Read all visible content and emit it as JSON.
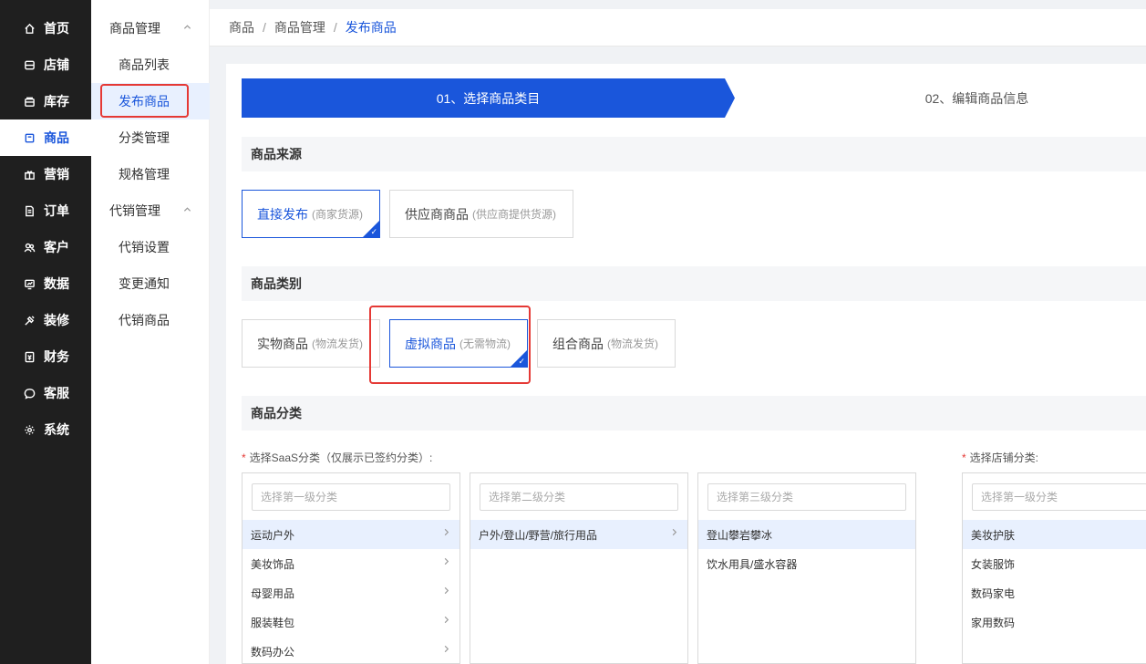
{
  "nav": {
    "items": [
      {
        "label": "首页",
        "icon": "home-icon"
      },
      {
        "label": "店铺",
        "icon": "store-icon"
      },
      {
        "label": "库存",
        "icon": "inventory-icon"
      },
      {
        "label": "商品",
        "icon": "product-icon"
      },
      {
        "label": "营销",
        "icon": "gift-icon"
      },
      {
        "label": "订单",
        "icon": "order-icon"
      },
      {
        "label": "客户",
        "icon": "customer-icon"
      },
      {
        "label": "数据",
        "icon": "data-icon"
      },
      {
        "label": "装修",
        "icon": "decorate-icon"
      },
      {
        "label": "财务",
        "icon": "finance-icon"
      },
      {
        "label": "客服",
        "icon": "chat-icon"
      },
      {
        "label": "系统",
        "icon": "settings-icon"
      }
    ],
    "active": "商品"
  },
  "submenu": {
    "group1": "商品管理",
    "group1_items": [
      "商品列表",
      "发布商品",
      "分类管理",
      "规格管理"
    ],
    "group2": "代销管理",
    "group2_items": [
      "代销设置",
      "变更通知",
      "代销商品"
    ]
  },
  "breadcrumb": [
    "商品",
    "商品管理",
    "发布商品"
  ],
  "steps": [
    "01、选择商品类目",
    "02、编辑商品信息"
  ],
  "source": {
    "title": "商品来源",
    "options": [
      {
        "label": "直接发布",
        "note": "(商家货源)"
      },
      {
        "label": "供应商商品",
        "note": "(供应商提供货源)"
      }
    ]
  },
  "type": {
    "title": "商品类别",
    "options": [
      {
        "label": "实物商品",
        "note": "(物流发货)"
      },
      {
        "label": "虚拟商品",
        "note": "(无需物流)"
      },
      {
        "label": "组合商品",
        "note": "(物流发货)"
      }
    ]
  },
  "category": {
    "title": "商品分类",
    "saas_label": "选择SaaS分类（仅展示已签约分类）:",
    "shop_label": "选择店铺分类:",
    "level1_placeholder": "选择第一级分类",
    "level2_placeholder": "选择第二级分类",
    "level3_placeholder": "选择第三级分类",
    "shop_placeholder": "选择第一级分类",
    "level1": [
      "运动户外",
      "美妆饰品",
      "母婴用品",
      "服装鞋包",
      "数码办公"
    ],
    "level2": [
      "户外/登山/野营/旅行用品"
    ],
    "level3": [
      "登山攀岩攀冰",
      "饮水用具/盛水容器"
    ],
    "shop": [
      "美妆护肤",
      "女装服饰",
      "数码家电",
      "家用数码"
    ]
  },
  "colors": {
    "accent": "#1a56db",
    "sidebar": "#1f1f1f",
    "highlight": "#e53935"
  }
}
